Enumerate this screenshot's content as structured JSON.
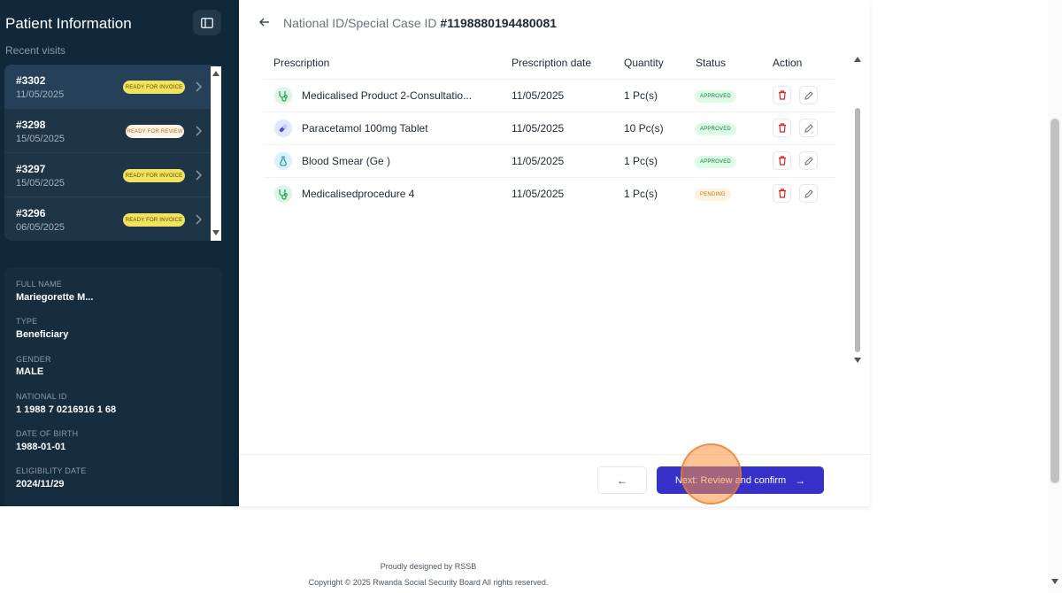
{
  "sidebar": {
    "title": "Patient Information",
    "subtitle": "Recent visits",
    "visits": [
      {
        "id": "#3302",
        "date": "11/05/2025",
        "badge": "READY FOR INVOICE"
      },
      {
        "id": "#3298",
        "date": "15/05/2025",
        "badge": "READY FOR REVIEW"
      },
      {
        "id": "#3297",
        "date": "15/05/2025",
        "badge": "READY FOR INVOICE"
      },
      {
        "id": "#3296",
        "date": "06/05/2025",
        "badge": "READY FOR INVOICE"
      }
    ],
    "fields": [
      {
        "label": "FULL NAME",
        "value": "Mariegorette M..."
      },
      {
        "label": "TYPE",
        "value": "Beneficiary"
      },
      {
        "label": "GENDER",
        "value": "MALE"
      },
      {
        "label": "NATIONAL ID",
        "value": "1 1988 7 0216916 1 68"
      },
      {
        "label": "DATE OF BIRTH",
        "value": "1988-01-01"
      },
      {
        "label": "ELIGIBILITY DATE",
        "value": "2024/11/29"
      }
    ]
  },
  "header": {
    "case_label": "National ID/Special Case ID",
    "case_id": "#1198880194480081"
  },
  "table": {
    "columns": [
      "Prescription",
      "Prescription date",
      "Quantity",
      "Status",
      "Action"
    ],
    "rows": [
      {
        "icon": "stethoscope-icon",
        "name": "Medicalised Product 2-Consultatio...",
        "date": "11/05/2025",
        "qty": "1 Pc(s)",
        "status": "APPROVED"
      },
      {
        "icon": "pill-icon",
        "name": "Paracetamol 100mg Tablet",
        "date": "11/05/2025",
        "qty": "10 Pc(s)",
        "status": "APPROVED"
      },
      {
        "icon": "test-tube-icon",
        "name": "Blood Smear (Ge )",
        "date": "11/05/2025",
        "qty": "1 Pc(s)",
        "status": "APPROVED"
      },
      {
        "icon": "stethoscope-icon",
        "name": "Medicalisedprocedure 4",
        "date": "11/05/2025",
        "qty": "1 Pc(s)",
        "status": "PENDING"
      }
    ]
  },
  "actions": {
    "prev_label": "←",
    "next_label": "Next: Review and confirm",
    "next_arrow": "→"
  },
  "footer": {
    "designed": "Proudly designed by RSSB",
    "copyright": "Copyright © 2025 Rwanda Social Security Board All rights reserved."
  },
  "colors": {
    "sidebar_bg": "#10283a",
    "accent": "#3730c9",
    "approved": "#15803d",
    "pending": "#c2780f",
    "ready_invoice": "#f2e35f"
  }
}
